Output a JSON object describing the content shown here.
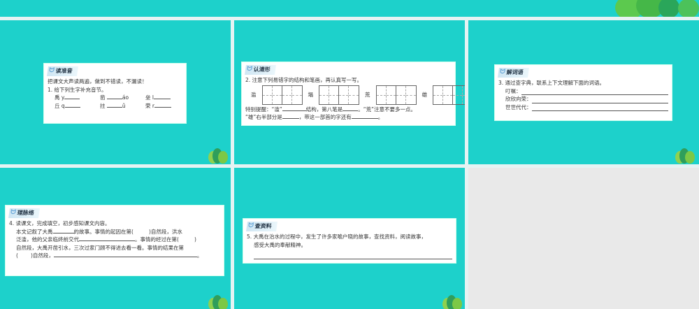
{
  "slide1": {
    "tag": "读准音",
    "intro": "把课文大声读两遍，做到不错读，不漏读！",
    "q": "1. 给下列生字补充音节。",
    "items": [
      [
        "禹",
        "y",
        ""
      ],
      [
        "凿",
        "",
        "áo"
      ],
      [
        "垒",
        "l",
        ""
      ],
      [
        "丘",
        "q",
        ""
      ],
      [
        "拄",
        "",
        "ǔ"
      ],
      [
        "荣",
        "r",
        ""
      ]
    ]
  },
  "slide2": {
    "tag": "认清形",
    "q": "2. 注意下列易错字的结构和笔画，再认真写一写。",
    "chars": [
      "滥",
      "塌",
      "荒",
      "雄"
    ],
    "line1a": "特别提醒：“滥”",
    "line1b": "结构，第八笔是",
    "line1c": "。“荒”注意不要多一点。",
    "line2a": "“雄”右半部分是",
    "line2b": "，带这一部首的字还有",
    "line2c": "。"
  },
  "slide3": {
    "tag": "解词语",
    "q": "3. 通过查字典，联系上下文理解下面的词语。",
    "words": [
      "叮嘱：",
      "欣欣向荣：",
      "世世代代："
    ]
  },
  "slide4": {
    "tag": "理脉络",
    "q": "4. 读课文，完成填空，初步感知课文内容。",
    "p1a": "本文记叙了大禹",
    "p1b": "的故事。事情的起因在第(",
    "p1c": ")自然段，洪水",
    "p2a": "泛滥，他的父亲临终前交代",
    "p2b": "。事情的经过在第(",
    "p2c": ")",
    "p3": "自然段，大禹开凿引水，三次过家门顾不得进去看一看。事情的结果在第",
    "p4a": "(",
    "p4b": ")自然段，",
    "p4c": "。"
  },
  "slide5": {
    "tag": "查资料",
    "q": "5. 大禹在治水的过程中，发生了许多家喻户晓的故事，查找资料，阅读故事，",
    "q2": "感受大禹的奉献精神。"
  }
}
